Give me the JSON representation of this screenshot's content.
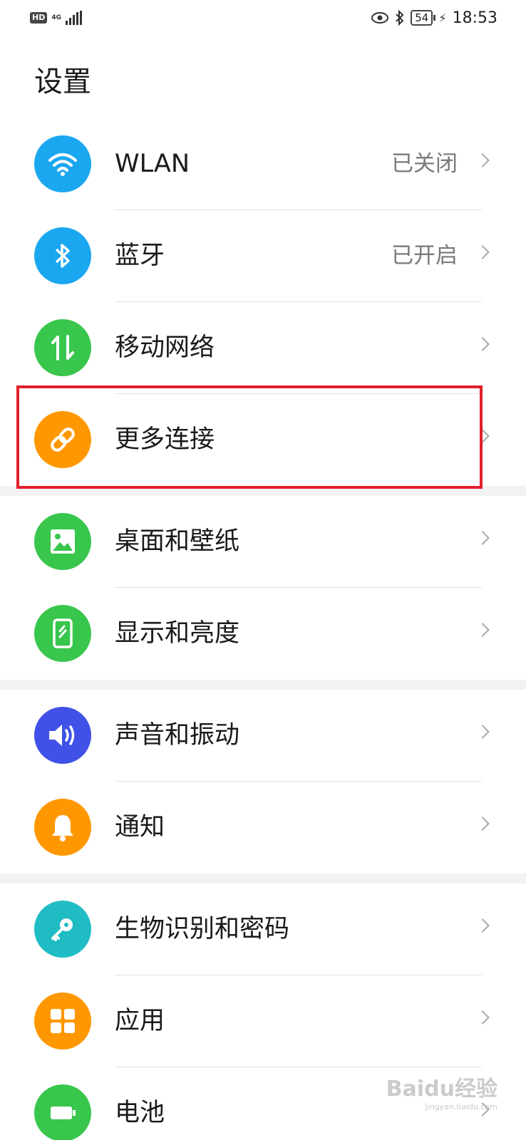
{
  "status_bar": {
    "hd": "HD",
    "network_type": "4G",
    "battery_level": "54",
    "time": "18:53"
  },
  "page": {
    "title": "设置"
  },
  "groups": [
    {
      "items": [
        {
          "label": "WLAN",
          "value": "已关闭",
          "icon": "wifi-icon",
          "color": "#1aa7f0"
        },
        {
          "label": "蓝牙",
          "value": "已开启",
          "icon": "bluetooth-icon",
          "color": "#1aa7f0"
        },
        {
          "label": "移动网络",
          "value": "",
          "icon": "mobile-data-icon",
          "color": "#38c64c"
        },
        {
          "label": "更多连接",
          "value": "",
          "icon": "link-icon",
          "color": "#ff9800"
        }
      ]
    },
    {
      "items": [
        {
          "label": "桌面和壁纸",
          "value": "",
          "icon": "wallpaper-icon",
          "color": "#38c64c"
        },
        {
          "label": "显示和亮度",
          "value": "",
          "icon": "display-icon",
          "color": "#38c64c"
        }
      ]
    },
    {
      "items": [
        {
          "label": "声音和振动",
          "value": "",
          "icon": "sound-icon",
          "color": "#3f51e6"
        },
        {
          "label": "通知",
          "value": "",
          "icon": "notification-bell-icon",
          "color": "#ff9800"
        }
      ]
    },
    {
      "items": [
        {
          "label": "生物识别和密码",
          "value": "",
          "icon": "key-icon",
          "color": "#1fbcc4"
        },
        {
          "label": "应用",
          "value": "",
          "icon": "apps-grid-icon",
          "color": "#ff9800"
        },
        {
          "label": "电池",
          "value": "",
          "icon": "battery-icon",
          "color": "#38c64c"
        }
      ]
    }
  ],
  "watermark": {
    "text": "Baidu经验",
    "sub": "jingyan.baidu.com"
  }
}
